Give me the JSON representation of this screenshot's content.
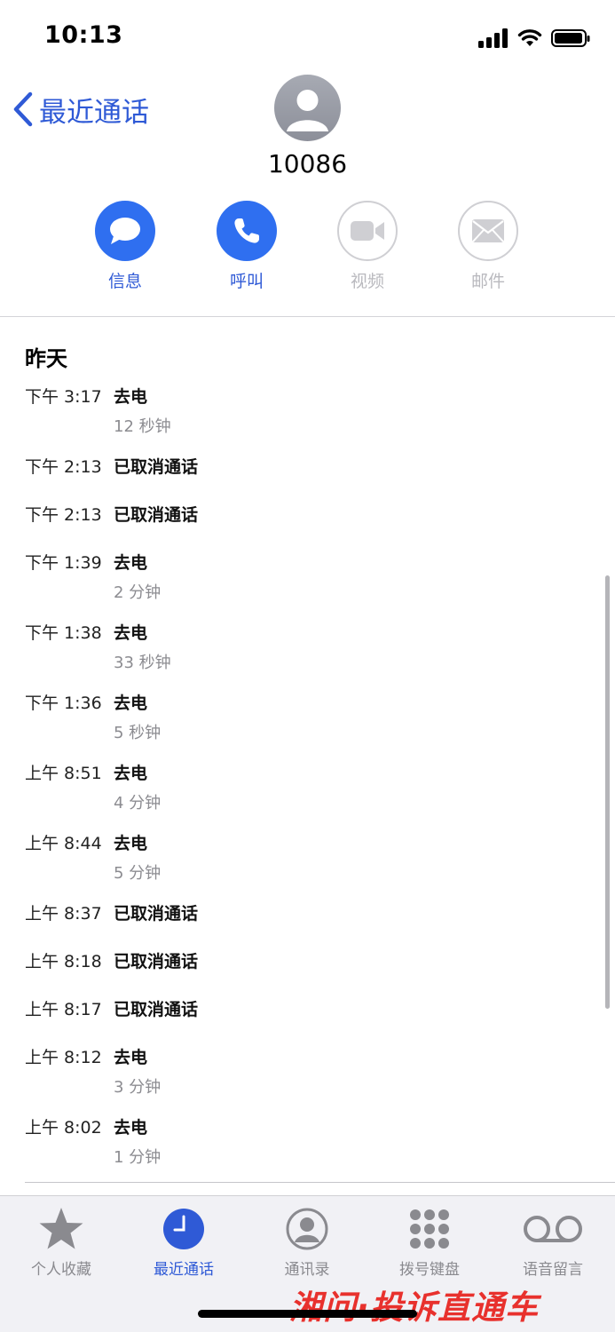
{
  "status": {
    "time": "10:13"
  },
  "header": {
    "back_label": "最近通话",
    "number": "10086"
  },
  "actions": [
    {
      "label": "信息",
      "icon": "message-bubble-icon",
      "enabled": true
    },
    {
      "label": "呼叫",
      "icon": "phone-icon",
      "enabled": true
    },
    {
      "label": "视频",
      "icon": "video-camera-icon",
      "enabled": false
    },
    {
      "label": "邮件",
      "icon": "mail-envelope-icon",
      "enabled": false
    }
  ],
  "section_title": "昨天",
  "calls": [
    {
      "time": "下午 3:17",
      "type": "去电",
      "duration": "12 秒钟"
    },
    {
      "time": "下午 2:13",
      "type": "已取消通话",
      "duration": ""
    },
    {
      "time": "下午 2:13",
      "type": "已取消通话",
      "duration": ""
    },
    {
      "time": "下午 1:39",
      "type": "去电",
      "duration": "2 分钟"
    },
    {
      "time": "下午 1:38",
      "type": "去电",
      "duration": "33 秒钟"
    },
    {
      "time": "下午 1:36",
      "type": "去电",
      "duration": "5 秒钟"
    },
    {
      "time": "上午 8:51",
      "type": "去电",
      "duration": "4 分钟"
    },
    {
      "time": "上午 8:44",
      "type": "去电",
      "duration": "5 分钟"
    },
    {
      "time": "上午 8:37",
      "type": "已取消通话",
      "duration": ""
    },
    {
      "time": "上午 8:18",
      "type": "已取消通话",
      "duration": ""
    },
    {
      "time": "上午 8:17",
      "type": "已取消通话",
      "duration": ""
    },
    {
      "time": "上午 8:12",
      "type": "去电",
      "duration": "3 分钟"
    },
    {
      "time": "上午 8:02",
      "type": "去电",
      "duration": "1 分钟"
    }
  ],
  "tabs": [
    {
      "label": "个人收藏",
      "icon": "star-icon",
      "active": false
    },
    {
      "label": "最近通话",
      "icon": "clock-icon",
      "active": true
    },
    {
      "label": "通讯录",
      "icon": "contact-person-icon",
      "active": false
    },
    {
      "label": "拨号键盘",
      "icon": "keypad-icon",
      "active": false
    },
    {
      "label": "语音留言",
      "icon": "voicemail-icon",
      "active": false
    }
  ],
  "watermark": "湘问·投诉直通车",
  "colors": {
    "accent": "#2f5ad6",
    "action_blue": "#2f6ff0",
    "disabled": "#b9b9be",
    "watermark": "#e8312d"
  }
}
